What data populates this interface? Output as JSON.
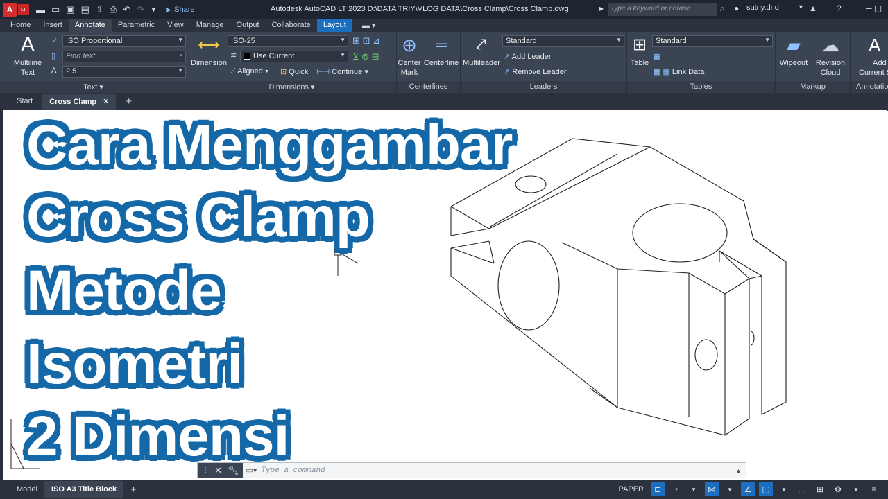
{
  "titlebar": {
    "app_badge": "A",
    "app_badge_sub": "LT",
    "share_label": "Share",
    "window_title": "Autodesk AutoCAD LT 2023    D:\\DATA TRIY\\VLOG DATA\\Cross Clamp\\Cross Clamp.dwg",
    "search_placeholder": "Type a keyword or phrase",
    "user_name": "sutriy.dnd"
  },
  "ribbon_tabs": [
    "Home",
    "Insert",
    "Annotate",
    "Parametric",
    "View",
    "Manage",
    "Output",
    "Collaborate",
    "Layout"
  ],
  "ribbon": {
    "text_panel": {
      "multiline_label_1": "Multiline",
      "multiline_label_2": "Text",
      "text_style": "ISO Proportional",
      "find_text_placeholder": "Find text",
      "text_height": "2.5",
      "panel_label": "Text"
    },
    "dimensions_panel": {
      "dimension_label": "Dimension",
      "dim_style": "ISO-25",
      "layer": "Use Current",
      "aligned_label": "Aligned",
      "quick_label": "Quick",
      "continue_label": "Continue",
      "panel_label": "Dimensions"
    },
    "centerlines_panel": {
      "center_mark_1": "Center",
      "center_mark_2": "Mark",
      "centerline_label": "Centerline",
      "panel_label": "Centerlines"
    },
    "leaders_panel": {
      "multileader_label": "Multileader",
      "style": "Standard",
      "add_leader": "Add Leader",
      "remove_leader": "Remove Leader",
      "panel_label": "Leaders"
    },
    "tables_panel": {
      "table_label": "Table",
      "style": "Standard",
      "link_data": "Link Data",
      "panel_label": "Tables"
    },
    "markup_panel": {
      "wipeout_label": "Wipeout",
      "revision_1": "Revision",
      "revision_2": "Cloud",
      "panel_label": "Markup"
    },
    "annotation_panel": {
      "add_label_1": "Add",
      "add_label_2": "Current S",
      "panel_label": "Annotatio"
    }
  },
  "file_tabs": {
    "start": "Start",
    "active": "Cross Clamp"
  },
  "headline": [
    "Cara Menggambar",
    "Cross Clamp",
    "Metode",
    "Isometri",
    "2 Dimensi"
  ],
  "command_line": {
    "placeholder": "Type a command"
  },
  "status_bar": {
    "model_tab": "Model",
    "layout_tab": "ISO A3 Title Block",
    "paper_label": "PAPER"
  },
  "colors": {
    "accent": "#1c6fbf",
    "headline_outline": "#1568a8",
    "ribbon_bg": "#3b4453",
    "titlebar_bg": "#1f2530"
  }
}
